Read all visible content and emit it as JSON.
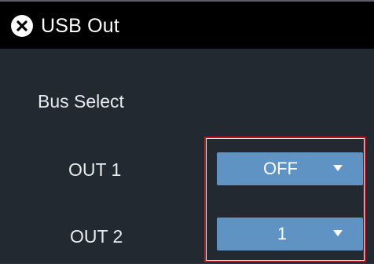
{
  "window": {
    "title": "USB Out",
    "close_icon": "close-icon"
  },
  "bus_select": {
    "label": "Bus Select",
    "outputs": [
      {
        "label": "OUT 1",
        "value": "OFF"
      },
      {
        "label": "OUT 2",
        "value": "1"
      }
    ]
  },
  "colors": {
    "panel_background": "#222930",
    "titlebar_background": "#000000",
    "dropdown_fill": "#5f93c4",
    "highlight_border": "#c3121e",
    "text": "#ffffff"
  }
}
